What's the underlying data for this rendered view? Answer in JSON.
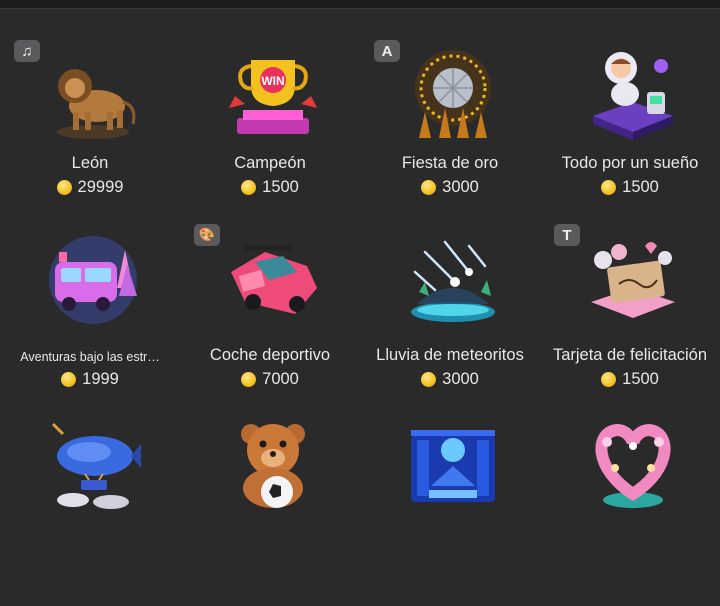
{
  "gifts": [
    {
      "name": "León",
      "price": "29999",
      "badge": "♫",
      "icon": "lion-icon"
    },
    {
      "name": "Campeón",
      "price": "1500",
      "badge": "",
      "icon": "trophy-icon"
    },
    {
      "name": "Fiesta de oro",
      "price": "3000",
      "badge": "A",
      "icon": "disco-ball-icon"
    },
    {
      "name": "Todo por un sueño",
      "price": "1500",
      "badge": "",
      "icon": "astronaut-icon"
    },
    {
      "name": "Aventuras bajo las estr…",
      "price": "1999",
      "badge": "",
      "icon": "camper-van-icon"
    },
    {
      "name": "Coche deportivo",
      "price": "7000",
      "badge": "🎨",
      "icon": "sports-car-icon"
    },
    {
      "name": "Lluvia de meteoritos",
      "price": "3000",
      "badge": "",
      "icon": "meteor-shower-icon"
    },
    {
      "name": "Tarjeta de felicitación",
      "price": "1500",
      "badge": "T",
      "icon": "greeting-card-icon"
    },
    {
      "name": "",
      "price": "",
      "badge": "",
      "icon": "airship-icon"
    },
    {
      "name": "",
      "price": "",
      "badge": "",
      "icon": "teddy-bear-football-icon"
    },
    {
      "name": "",
      "price": "",
      "badge": "",
      "icon": "stage-icon"
    },
    {
      "name": "",
      "price": "",
      "badge": "",
      "icon": "flower-heart-icon"
    }
  ],
  "colors": {
    "background": "#2a2a2b",
    "coin": "#f3c21f",
    "badge": "#5a5a5c"
  }
}
